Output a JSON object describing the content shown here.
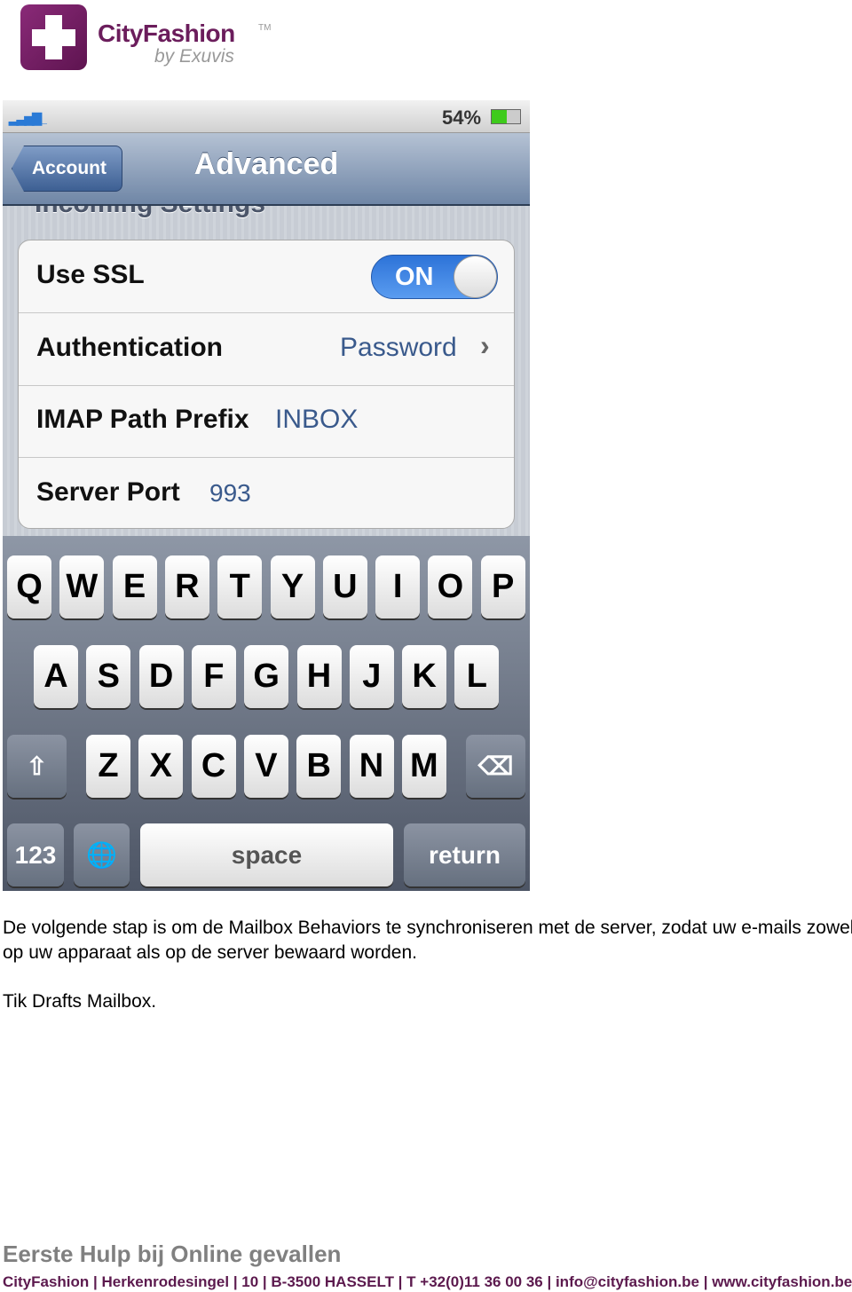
{
  "logo": {
    "brand": "CityFashion",
    "tm": "TM",
    "sub": "by Exuvis",
    "color": "#6b1d5c"
  },
  "phone": {
    "status": {
      "battery_pct": "54%",
      "battery_level": 54,
      "signal-icon": "signal-bars"
    },
    "nav": {
      "back": "Account",
      "title": "Advanced"
    },
    "section": "Incoming Settings",
    "rows": [
      {
        "label": "Use SSL",
        "toggle": "ON",
        "toggle_on": true
      },
      {
        "label": "Authentication",
        "value": "Password"
      },
      {
        "label": "IMAP Path Prefix",
        "value": "INBOX"
      },
      {
        "label": "Server Port",
        "value": "993"
      }
    ],
    "keyboard": {
      "row1": [
        "Q",
        "W",
        "E",
        "R",
        "T",
        "Y",
        "U",
        "I",
        "O",
        "P"
      ],
      "row2": [
        "A",
        "S",
        "D",
        "F",
        "G",
        "H",
        "J",
        "K",
        "L"
      ],
      "row3": [
        "Z",
        "X",
        "C",
        "V",
        "B",
        "N",
        "M"
      ],
      "numbers": "123",
      "space": "space",
      "return": "return"
    }
  },
  "body": {
    "p1": "De volgende stap is om de Mailbox Behaviors te synchroniseren met de server, zodat uw e-mails zowel op uw apparaat als op de server bewaard worden.",
    "p2": "Tik Drafts Mailbox."
  },
  "footer": {
    "heading": "Eerste Hulp bij Online gevallen",
    "address": "CityFashion | Herkenrodesingel | 10 | B-3500 HASSELT | T +32(0)11 36 00 36 | info@cityfashion.be | www.cityfashion.be"
  }
}
